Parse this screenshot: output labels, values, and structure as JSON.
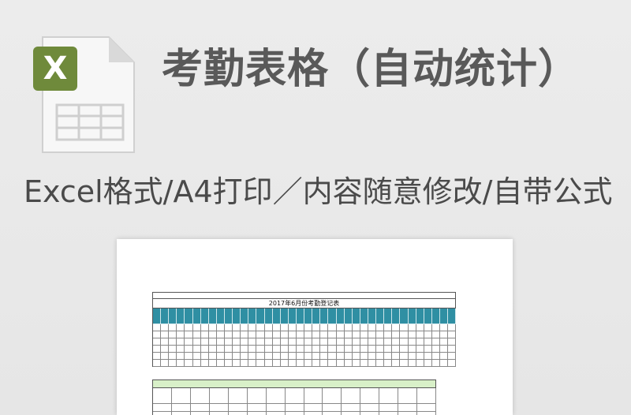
{
  "header": {
    "icon_letter": "X",
    "title": "考勤表格（自动统计）",
    "subtitle": "Excel格式/A4打印／内容随意修改/自带公式"
  },
  "colors": {
    "background": "#e8e8e8",
    "excel_green": "#6f8a3b",
    "header_teal": "#2f8fa3",
    "summary_green": "#d8f0c8"
  },
  "preview": {
    "sheet_title": "2017年6月份考勤登记表"
  }
}
